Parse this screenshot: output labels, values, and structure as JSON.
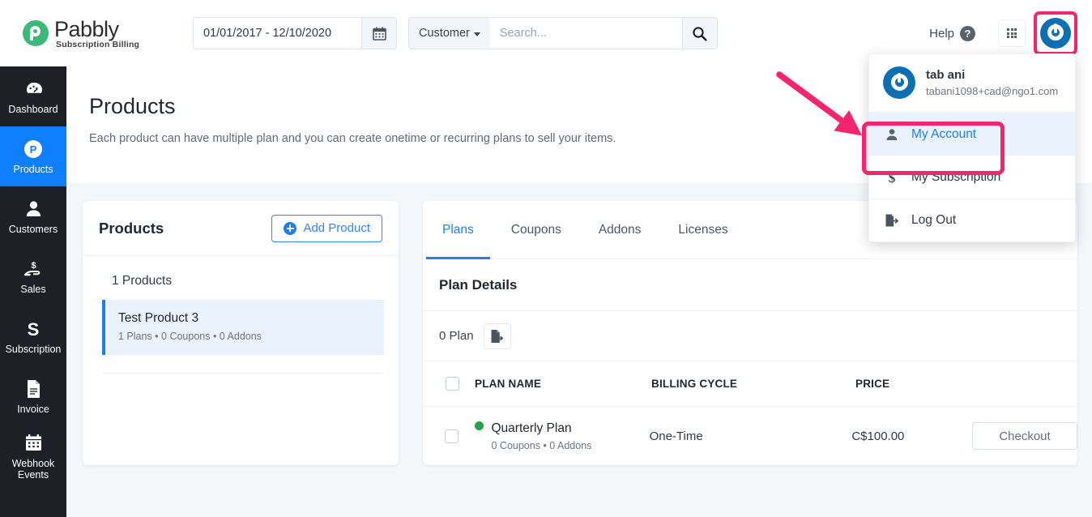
{
  "brand": {
    "name": "Pabbly",
    "tagline": "Subscription Billing"
  },
  "header": {
    "date_range_value": "01/01/2017 - 12/10/2020",
    "calendar_icon": "calendar-icon",
    "search_scope": "Customer",
    "search_placeholder": "Search...",
    "search_value": "",
    "search_icon": "search-icon",
    "help_label": "Help",
    "help_icon": "question-circle-icon",
    "apps_icon": "grid-apps-icon",
    "account_icon": "power-avatar-icon"
  },
  "sidebar": {
    "items": [
      {
        "label": "Dashboard",
        "icon": "speedometer-icon",
        "active": false
      },
      {
        "label": "Products",
        "icon": "pabbly-p-icon",
        "active": true
      },
      {
        "label": "Customers",
        "icon": "person-icon",
        "active": false
      },
      {
        "label": "Sales",
        "icon": "hand-coin-icon",
        "active": false
      },
      {
        "label": "Subscription",
        "icon": "letter-s-icon",
        "active": false
      },
      {
        "label": "Invoice",
        "icon": "document-icon",
        "active": false
      },
      {
        "label": "Webhook Events",
        "icon": "calendar-icon",
        "active": false
      }
    ]
  },
  "page": {
    "title": "Products",
    "description": "Each product can have multiple plan and you can create onetime or recurring plans to sell your items."
  },
  "products_panel": {
    "title": "Products",
    "add_button": "Add Product",
    "add_icon": "plus-circle-icon",
    "count_label": "1 Products",
    "items": [
      {
        "name": "Test Product 3",
        "meta": "1 Plans  • 0 Coupons  • 0 Addons"
      }
    ]
  },
  "plans_panel": {
    "tabs": [
      {
        "label": "Plans",
        "active": true
      },
      {
        "label": "Coupons",
        "active": false
      },
      {
        "label": "Addons",
        "active": false
      },
      {
        "label": "Licenses",
        "active": false
      }
    ],
    "section_title": "Plan Details",
    "plan_count": "0 Plan",
    "export_icon": "export-file-icon",
    "columns": [
      "",
      "PLAN NAME",
      "BILLING CYCLE",
      "PRICE",
      ""
    ],
    "rows": [
      {
        "status": "active",
        "name": "Quarterly Plan",
        "meta": "0 Coupons  • 0 Addons",
        "billing_cycle": "One-Time",
        "price": "C$100.00",
        "action": "Checkout"
      }
    ]
  },
  "account_dropdown": {
    "user_name": "tab ani",
    "user_email": "tabani1098+cad@ngo1.com",
    "avatar_icon": "power-avatar-icon",
    "items": [
      {
        "label": "My Account",
        "icon": "person-icon",
        "highlighted": true
      },
      {
        "label": "My Subscription",
        "icon": "dollar-icon",
        "highlighted": false
      },
      {
        "label": "Log Out",
        "icon": "logout-icon",
        "highlighted": false
      }
    ]
  },
  "annotation": {
    "highlight_color": "#f4256c",
    "arrow": "red-arrow-pointing-to-my-account"
  }
}
